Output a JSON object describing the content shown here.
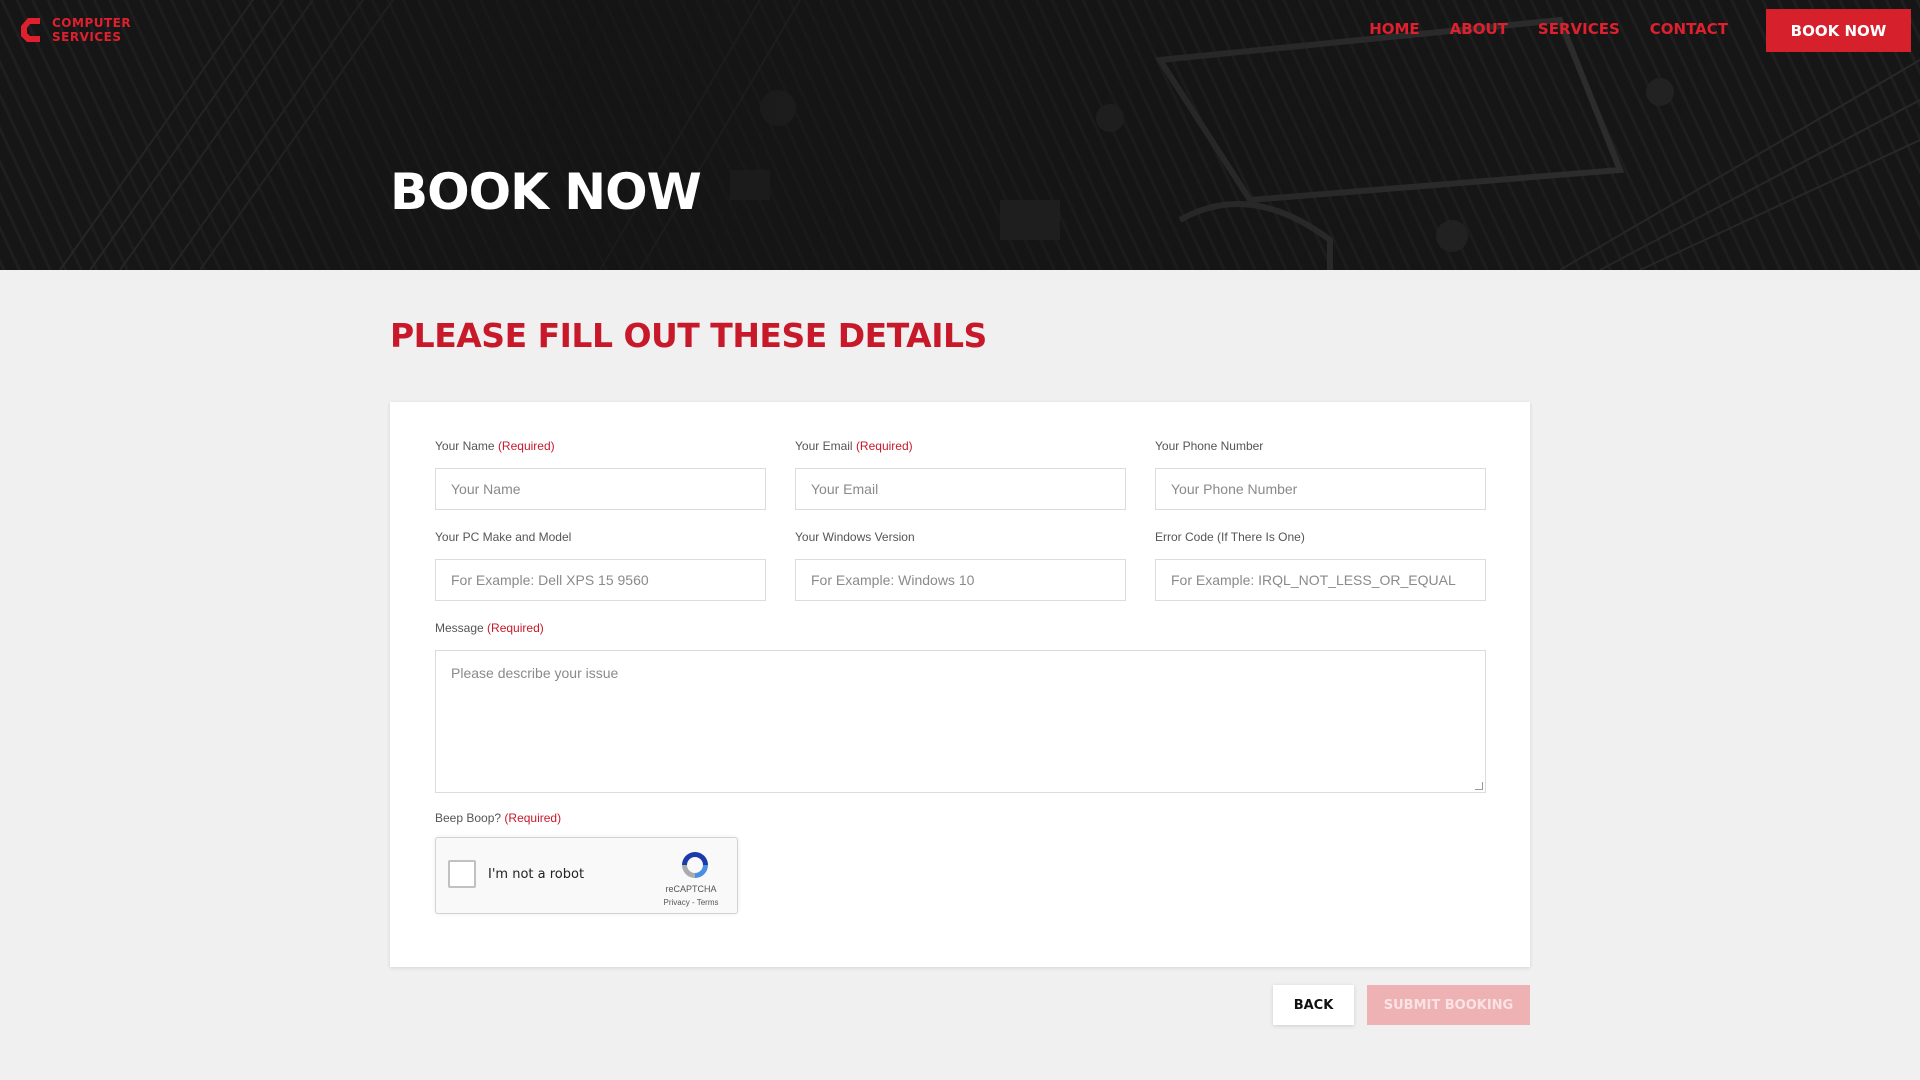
{
  "brand": {
    "line1": "COMPUTER",
    "line2": "SERVICES",
    "accent": "#e0202f"
  },
  "nav": {
    "items": [
      {
        "label": "HOME"
      },
      {
        "label": "ABOUT"
      },
      {
        "label": "SERVICES"
      },
      {
        "label": "CONTACT"
      }
    ],
    "cta": "BOOK NOW"
  },
  "hero": {
    "title": "BOOK NOW"
  },
  "section": {
    "title": "PLEASE FILL OUT THESE DETAILS",
    "color": "#c8192a"
  },
  "form": {
    "required_tag": "(Required)",
    "name": {
      "label": "Your Name",
      "placeholder": "Your Name",
      "value": ""
    },
    "email": {
      "label": "Your Email",
      "placeholder": "Your Email",
      "value": ""
    },
    "phone": {
      "label": "Your Phone Number",
      "placeholder": "Your Phone Number",
      "value": ""
    },
    "pc_model": {
      "label": "Your PC Make and Model",
      "placeholder": "For Example: Dell XPS 15 9560",
      "value": ""
    },
    "windows": {
      "label": "Your Windows Version",
      "placeholder": "For Example: Windows 10",
      "value": ""
    },
    "error_code": {
      "label": "Error Code (If There Is One)",
      "placeholder": "For Example: IRQL_NOT_LESS_OR_EQUAL",
      "value": ""
    },
    "message": {
      "label": "Message",
      "placeholder": "Please describe your issue",
      "value": ""
    },
    "captcha": {
      "label": "Beep Boop?",
      "checkbox_text": "I'm not a robot",
      "brand": "reCAPTCHA",
      "links": "Privacy - Terms"
    }
  },
  "actions": {
    "back": "BACK",
    "submit": "SUBMIT BOOKING"
  }
}
